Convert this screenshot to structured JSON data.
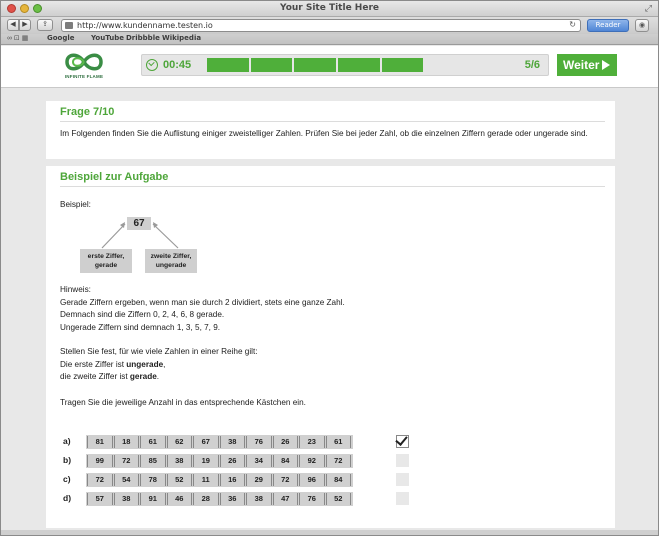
{
  "browser": {
    "window_title": "Your Site Title Here",
    "url": "http://www.kundenname.testen.io",
    "reader_label": "Reader",
    "bookmarks": [
      "Google",
      "YouTube",
      "Dribbble",
      "Wikipedia"
    ]
  },
  "header": {
    "logo_text": "INFINITE FLAME",
    "timer": "00:45",
    "progress": {
      "completed": 5,
      "total": 6
    },
    "step_label": "5/6",
    "next_label": "Weiter"
  },
  "question": {
    "title": "Frage 7/10",
    "text": "Im Folgenden finden Sie die Auflistung einiger zweistelliger Zahlen. Prüfen Sie bei jeder Zahl, ob die einzelnen Ziffern gerade oder ungerade sind."
  },
  "example": {
    "title": "Beispiel zur Aufgabe",
    "label": "Beispiel:",
    "number": "67",
    "callout_first": "erste Ziffer, gerade",
    "callout_second": "zweite Ziffer, ungerade",
    "hint_title": "Hinweis:",
    "hint_lines": [
      "Gerade Ziffern ergeben, wenn man sie durch 2 dividiert, stets eine ganze Zahl.",
      "Demnach sind die Ziffern 0, 2, 4, 6, 8 gerade.",
      "Ungerade Ziffern sind demnach 1, 3, 5, 7, 9."
    ],
    "task_line1": "Stellen Sie fest, für wie viele Zahlen in einer Reihe gilt:",
    "task_line2_pre": "Die erste Ziffer ist ",
    "task_line2_bold": "ungerade",
    "task_line2_post": ",",
    "task_line3_pre": "die zweite Ziffer ist ",
    "task_line3_bold": "gerade",
    "task_line3_post": ".",
    "final_line": "Tragen Sie die jeweilige Anzahl in das entsprechende Kästchen ein."
  },
  "rows": [
    {
      "label": "a)",
      "numbers": [
        "81",
        "18",
        "61",
        "62",
        "67",
        "38",
        "76",
        "26",
        "23",
        "61"
      ],
      "checked": true
    },
    {
      "label": "b)",
      "numbers": [
        "99",
        "72",
        "85",
        "38",
        "19",
        "26",
        "34",
        "84",
        "92",
        "72"
      ],
      "checked": false
    },
    {
      "label": "c)",
      "numbers": [
        "72",
        "54",
        "78",
        "52",
        "11",
        "16",
        "29",
        "72",
        "96",
        "84"
      ],
      "checked": false
    },
    {
      "label": "d)",
      "numbers": [
        "57",
        "38",
        "91",
        "46",
        "28",
        "36",
        "38",
        "47",
        "76",
        "52"
      ],
      "checked": false
    }
  ]
}
